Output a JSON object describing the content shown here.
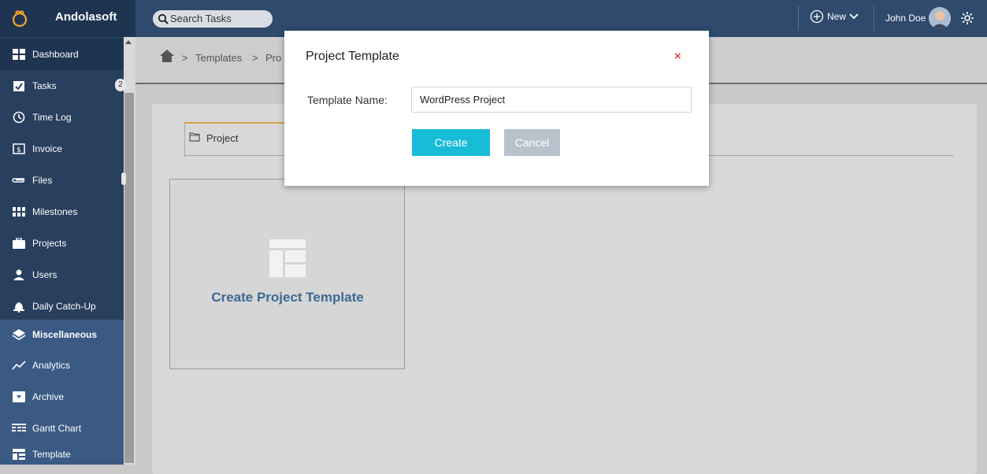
{
  "app": {
    "brand": "Andolasoft"
  },
  "topbar": {
    "search_placeholder": "Search Tasks",
    "new_label": "New",
    "user_name": "John Doe"
  },
  "sidebar": {
    "items": [
      {
        "label": "Dashboard",
        "icon": "dashboard-icon"
      },
      {
        "label": "Tasks",
        "icon": "tasks-icon"
      },
      {
        "label": "Time Log",
        "icon": "clock-icon"
      },
      {
        "label": "Invoice",
        "icon": "invoice-icon"
      },
      {
        "label": "Files",
        "icon": "paperclip-icon"
      },
      {
        "label": "Milestones",
        "icon": "milestones-icon"
      },
      {
        "label": "Projects",
        "icon": "briefcase-icon"
      },
      {
        "label": "Users",
        "icon": "user-icon"
      },
      {
        "label": "Daily Catch-Up",
        "icon": "bell-icon"
      },
      {
        "label": "Miscellaneous",
        "icon": "layers-icon"
      },
      {
        "label": "Analytics",
        "icon": "analytics-icon"
      },
      {
        "label": "Archive",
        "icon": "archive-icon"
      },
      {
        "label": "Gantt Chart",
        "icon": "gantt-icon"
      },
      {
        "label": "Template",
        "icon": "template-icon"
      }
    ],
    "tasks_badge": "2"
  },
  "breadcrumb": {
    "items": [
      "Templates",
      "Pro"
    ]
  },
  "tabs": [
    {
      "label": "Project"
    }
  ],
  "card": {
    "label": "Create Project Template"
  },
  "modal": {
    "title": "Project Template",
    "close": "×",
    "field_label": "Template Name:",
    "field_value": "WordPress Project",
    "create_label": "Create",
    "cancel_label": "Cancel"
  },
  "colors": {
    "accent": "#17bcd7",
    "sidebar": "#283f5e",
    "topbar": "#2f4a6d",
    "close": "#e24b4b",
    "tab_accent": "#d9a14b"
  }
}
